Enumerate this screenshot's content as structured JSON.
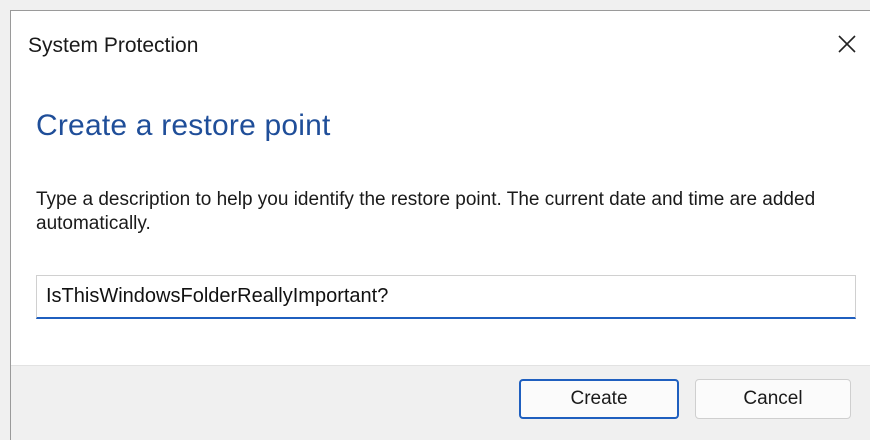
{
  "window": {
    "title": "System Protection",
    "close_icon": "close-icon"
  },
  "main": {
    "heading": "Create a restore point",
    "description": "Type a description to help you identify the restore point. The current date and time are added automatically.",
    "description_field": {
      "value": "IsThisWindowsFolderReallyImportant?",
      "placeholder": ""
    }
  },
  "footer": {
    "create_label": "Create",
    "cancel_label": "Cancel"
  },
  "colors": {
    "heading": "#1f4e99",
    "accent": "#1f5fbf",
    "footer_bg": "#f0f0f0"
  }
}
